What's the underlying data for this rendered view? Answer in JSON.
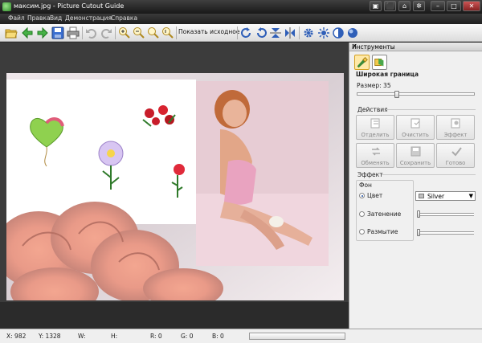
{
  "window": {
    "title": "максим.jpg - Picture Cutout Guide"
  },
  "menu": {
    "items": [
      "Файл",
      "Правка",
      "Вид",
      "Демонстрация",
      "Справка"
    ]
  },
  "toolbar": {
    "show_original_label": "Показать исходное",
    "icons": [
      "open-icon",
      "back-icon",
      "forward-icon",
      "save-icon",
      "print-icon",
      "undo-icon",
      "redo-icon",
      "zoom-in-icon",
      "zoom-out-icon",
      "zoom-fit-icon",
      "zoom-actual-icon",
      "rotate-right-icon",
      "rotate-left-icon",
      "flip-vertical-icon",
      "flip-horizontal-icon",
      "settings-icon",
      "brightness-icon",
      "contrast-icon",
      "color-icon"
    ]
  },
  "panel": {
    "header": "Инструменты",
    "tool_section_title": "Широкая граница",
    "size_label": "Размер: 35",
    "size_value": 35,
    "actions_title": "Действия",
    "action_buttons": [
      "Отделить",
      "Очистить",
      "Эффект",
      "Обменять",
      "Сохранить",
      "Готово"
    ],
    "effect_title": "Эффект",
    "background_title": "Фон",
    "radio_options": [
      "Цвет",
      "Затенение",
      "Размытие"
    ],
    "selected_radio": "Цвет",
    "color_select_value": "Silver",
    "accent_color": "#c0c0c0"
  },
  "status": {
    "x": "X: 982",
    "y": "Y: 1328",
    "w": "W:",
    "h": "H:",
    "r": "R: 0",
    "g": "G: 0",
    "b": "B: 0"
  }
}
